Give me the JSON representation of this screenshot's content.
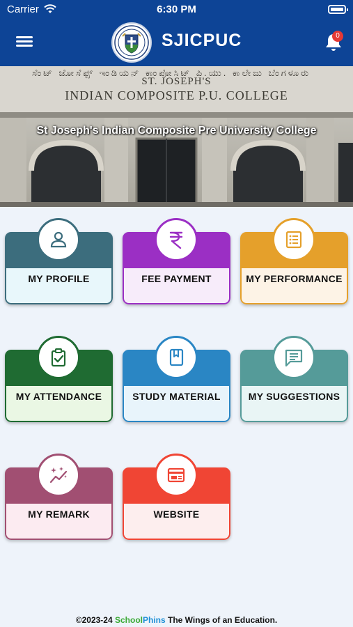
{
  "status_bar": {
    "carrier": "Carrier",
    "time": "6:30 PM"
  },
  "header": {
    "title": "SJICPUC",
    "notification_count": "0"
  },
  "banner": {
    "kannada_text": "ಸೆಂಟ್ ಜೋಸೆಫ್ಸ್ ಇಂಡಿಯನ್ ಕಾಂಪೋಸಿಟ್ ಪಿ.ಯು. ಕಾಲೇಜು ಬೆಂಗಳೂರು",
    "building_sign_line1": "ST. JOSEPH'S",
    "building_sign_line2": "INDIAN COMPOSITE P.U. COLLEGE",
    "caption": "St Joseph's Indian Composite Pre University College"
  },
  "tiles": [
    {
      "label": "MY PROFILE",
      "icon": "user-icon",
      "top_color": "#3c6d7d",
      "bottom_color": "#e8f7fb"
    },
    {
      "label": "FEE PAYMENT",
      "icon": "rupee-icon",
      "top_color": "#9b2fc4",
      "bottom_color": "#f7ecfa"
    },
    {
      "label": "MY PERFORMANCE",
      "icon": "report-list-icon",
      "top_color": "#e5a02b",
      "bottom_color": "#fdf3e6"
    },
    {
      "label": "MY ATTENDANCE",
      "icon": "clipboard-check-icon",
      "top_color": "#1f6b32",
      "bottom_color": "#eaf7e4"
    },
    {
      "label": "STUDY MATERIAL",
      "icon": "book-icon",
      "top_color": "#2a86c4",
      "bottom_color": "#e8f4fb"
    },
    {
      "label": "MY SUGGESTIONS",
      "icon": "message-icon",
      "top_color": "#559b99",
      "bottom_color": "#e9f5f5"
    },
    {
      "label": "MY REMARK",
      "icon": "sparkle-chart-icon",
      "top_color": "#a14f72",
      "bottom_color": "#fcebf1"
    },
    {
      "label": "WEBSITE",
      "icon": "web-window-icon",
      "top_color": "#f04534",
      "bottom_color": "#fdeeee"
    }
  ],
  "footer": {
    "prefix": "©2023-24",
    "brand_school": "School",
    "brand_phins": "Phins",
    "suffix": "The Wings of an Education."
  }
}
